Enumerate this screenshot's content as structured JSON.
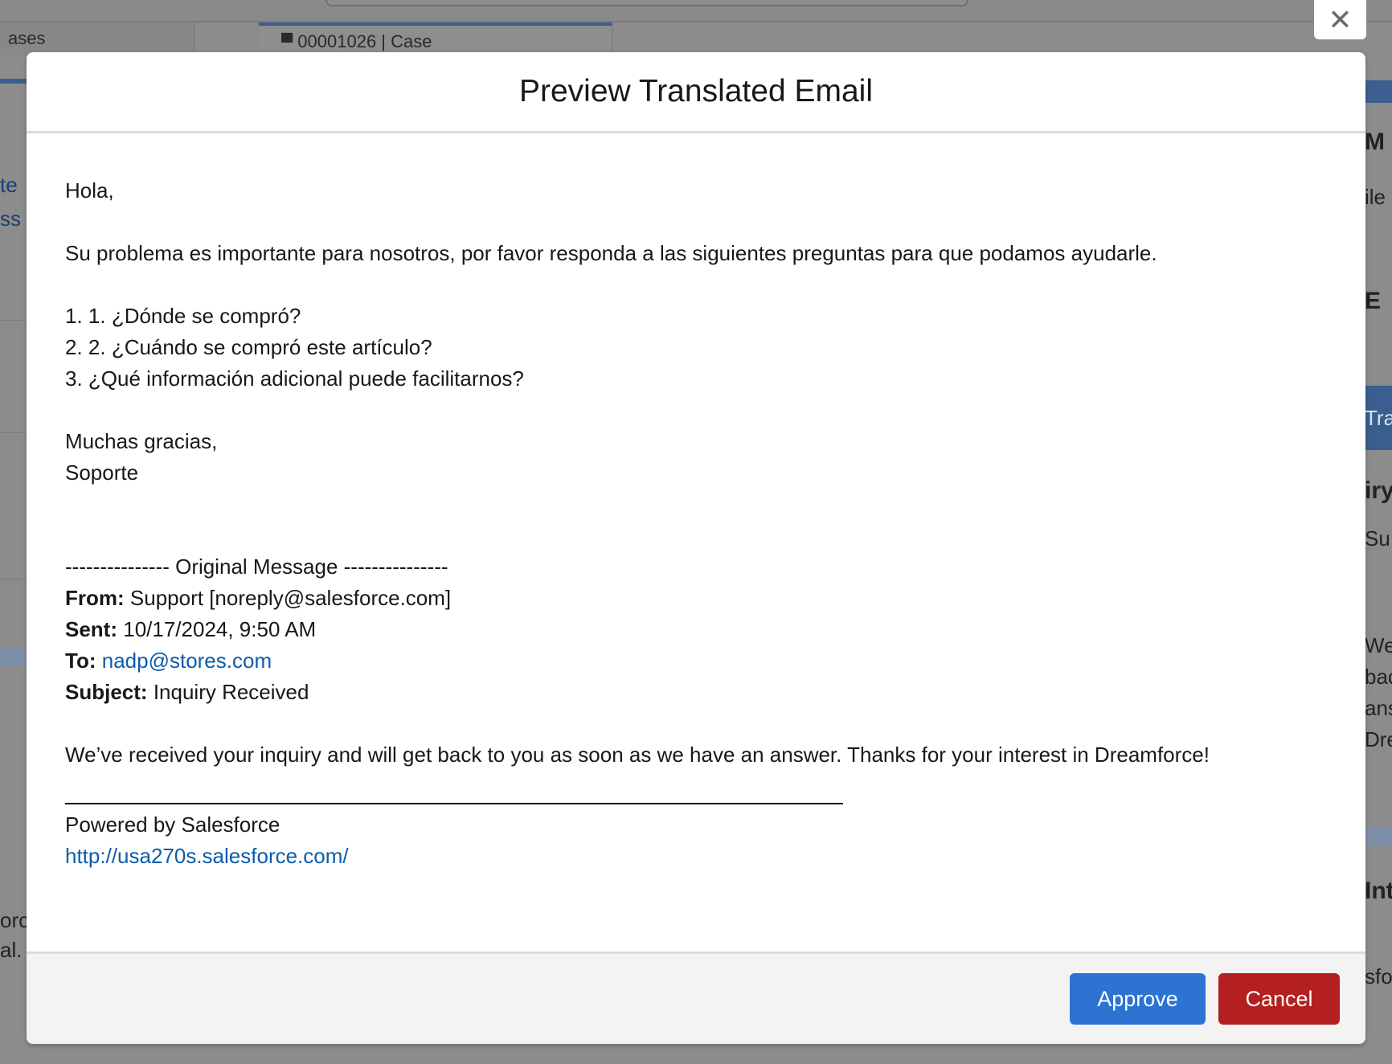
{
  "background": {
    "tabs": [
      {
        "label": "ases"
      },
      {
        "label": "00001026 | Case"
      }
    ],
    "left_fragments": [
      "te",
      "ss",
      "orc",
      "al."
    ],
    "right_fragments": [
      "M",
      "ile",
      "E",
      "Tra",
      "iry",
      "Su",
      "We",
      "bac",
      "ans",
      "Dre",
      "Int",
      "sfo"
    ]
  },
  "close": {
    "glyph": "✕"
  },
  "modal": {
    "title": "Preview Translated Email",
    "body": {
      "greeting": "Hola,",
      "intro": "Su problema es importante para nosotros, por favor responda a las siguientes preguntas para que podamos ayudarle.",
      "questions": [
        "1. 1. ¿Dónde se compró?",
        "2. 2. ¿Cuándo se compró este artículo?",
        "3. ¿Qué información adicional puede facilitarnos?"
      ],
      "closing": "Muchas gracias,",
      "signature": "Soporte",
      "original_header": "--------------- Original Message ---------------",
      "from_label": "From:",
      "from_value": "Support [noreply@salesforce.com]",
      "sent_label": "Sent:",
      "sent_value": "10/17/2024, 9:50 AM",
      "to_label": "To:",
      "to_value": "nadp@stores.com",
      "subject_label": "Subject:",
      "subject_value": "Inquiry Received",
      "original_body": "We’ve received your inquiry and will get back to you as soon as we have an answer. Thanks for your interest in Dreamforce!",
      "powered_by": "Powered by Salesforce",
      "powered_link": "http://usa270s.salesforce.com/"
    },
    "footer": {
      "approve_label": "Approve",
      "cancel_label": "Cancel"
    }
  },
  "colors": {
    "approve": "#2c73d2",
    "cancel": "#b3201f",
    "link": "#0b5cab",
    "overlay": "#8c8c8c"
  }
}
